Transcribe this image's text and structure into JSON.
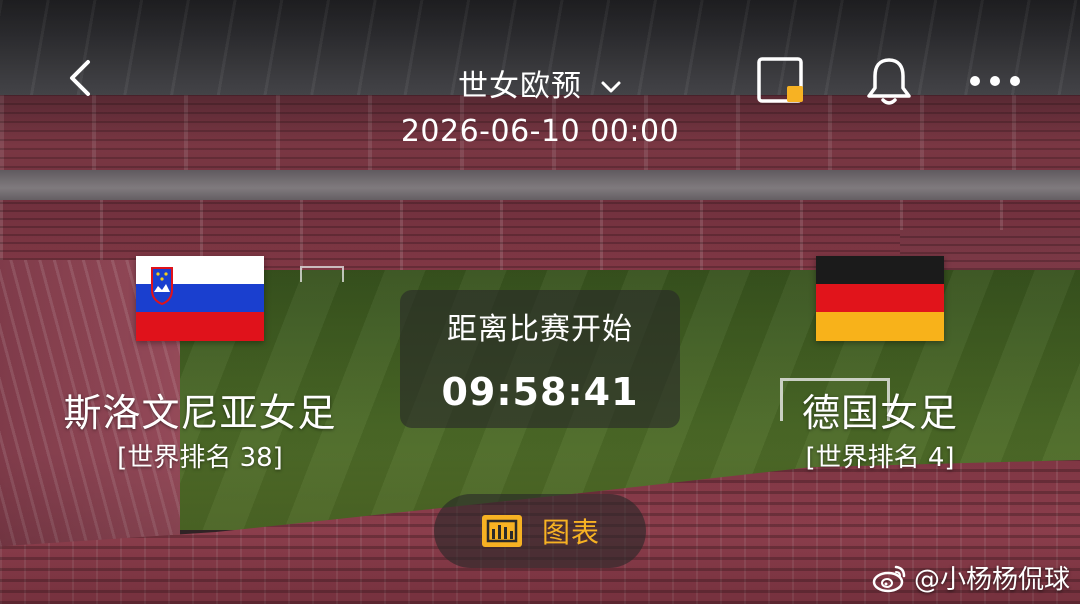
{
  "header": {
    "competition_title": "世女欧预",
    "match_datetime": "2026-06-10 00:00"
  },
  "home_team": {
    "name": "斯洛文尼亚女足",
    "rank_text": "[世界排名 38]",
    "flag": "slovenia-flag"
  },
  "away_team": {
    "name": "德国女足",
    "rank_text": "[世界排名 4]",
    "flag": "germany-flag"
  },
  "countdown": {
    "label": "距离比赛开始",
    "value": "09:58:41"
  },
  "chart_button": {
    "label": "图表",
    "icon": "bar-chart-icon"
  },
  "watermark": {
    "text": "@小杨杨侃球",
    "icon": "weibo-icon"
  },
  "icons": {
    "back": "chevron-left-icon",
    "dropdown": "chevron-down-icon",
    "pip": "picture-in-picture-icon",
    "notify": "bell-icon",
    "more": "more-dots-icon"
  },
  "colors": {
    "accent": "#f7b223",
    "panel": "rgba(40,40,40,0.62)",
    "text": "#ffffff"
  }
}
